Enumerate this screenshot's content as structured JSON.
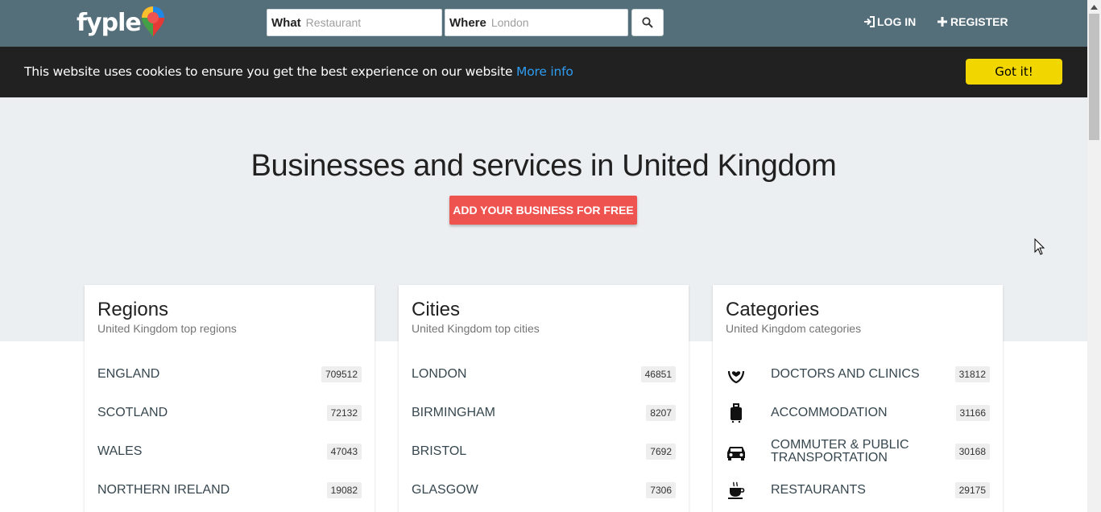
{
  "header": {
    "logo": "fyple",
    "what_label": "What",
    "what_placeholder": "Restaurant",
    "where_label": "Where",
    "where_placeholder": "London",
    "login_label": "LOG IN",
    "register_label": "REGISTER"
  },
  "cookie": {
    "text": "This website uses cookies to ensure you get the best experience on our website",
    "more_info": "More info",
    "button": "Got it!"
  },
  "hero": {
    "title": "Businesses and services in United Kingdom",
    "button": "ADD YOUR BUSINESS FOR FREE"
  },
  "regions": {
    "title": "Regions",
    "subtitle": "United Kingdom top regions",
    "items": [
      {
        "name": "ENGLAND",
        "count": "709512"
      },
      {
        "name": "SCOTLAND",
        "count": "72132"
      },
      {
        "name": "WALES",
        "count": "47043"
      },
      {
        "name": "NORTHERN IRELAND",
        "count": "19082"
      }
    ]
  },
  "cities": {
    "title": "Cities",
    "subtitle": "United Kingdom top cities",
    "items": [
      {
        "name": "LONDON",
        "count": "46851"
      },
      {
        "name": "BIRMINGHAM",
        "count": "8207"
      },
      {
        "name": "BRISTOL",
        "count": "7692"
      },
      {
        "name": "GLASGOW",
        "count": "7306"
      }
    ]
  },
  "categories": {
    "title": "Categories",
    "subtitle": "United Kingdom categories",
    "items": [
      {
        "name": "DOCTORS AND CLINICS",
        "count": "31812",
        "icon": "heart-hand-icon"
      },
      {
        "name": "ACCOMMODATION",
        "count": "31166",
        "icon": "luggage-icon"
      },
      {
        "name": "COMMUTER & PUBLIC TRANSPORTATION",
        "count": "30168",
        "icon": "car-icon"
      },
      {
        "name": "RESTAURANTS",
        "count": "29175",
        "icon": "coffee-cup-icon"
      }
    ]
  },
  "colors": {
    "header_bg": "#546e7a",
    "cookie_bg": "#212121",
    "cookie_link": "#2f9cf0",
    "cookie_button": "#f1d600",
    "cta_button": "#ef5350",
    "hero_bg": "#eceff1"
  }
}
